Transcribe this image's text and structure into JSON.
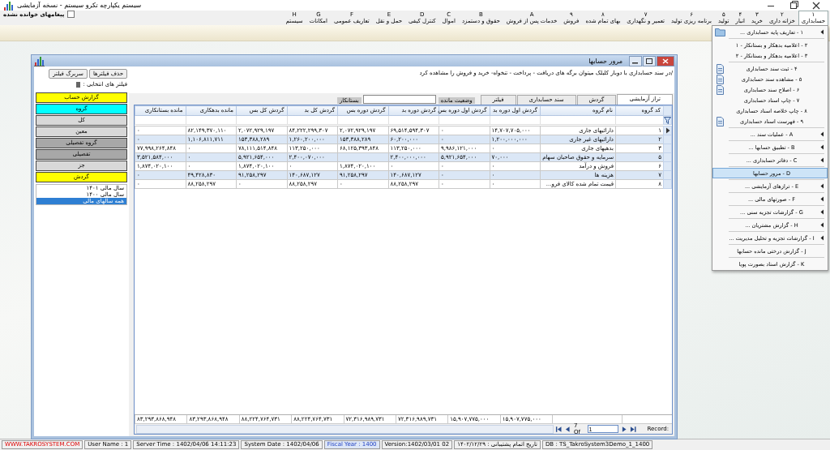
{
  "app_title": "سیستم یکپارچه تکرو سیستم - نسخه آزمایشی",
  "unread_messages": {
    "label": "پیغامهای خوانده نشده",
    "checked": false
  },
  "menu": [
    {
      "key": "۱",
      "label": "حسابداری",
      "selected": true
    },
    {
      "key": "۲",
      "label": "خزانه داری",
      "selected": false
    },
    {
      "key": "۳",
      "label": "خرید",
      "selected": false
    },
    {
      "key": "۴",
      "label": "انبار",
      "selected": false
    },
    {
      "key": "۵",
      "label": "تولید",
      "selected": false
    },
    {
      "key": "۶",
      "label": "برنامه ریزی تولید",
      "selected": false
    },
    {
      "key": "۷",
      "label": "تعمیر و نگهداری",
      "selected": false
    },
    {
      "key": "۸",
      "label": "بهای تمام شده",
      "selected": false
    },
    {
      "key": "۹",
      "label": "فروش",
      "selected": false
    },
    {
      "key": "A",
      "label": "خدمات پس از فروش",
      "selected": false
    },
    {
      "key": "B",
      "label": "حقوق و دستمزد",
      "selected": false
    },
    {
      "key": "C",
      "label": "اموال",
      "selected": false
    },
    {
      "key": "D",
      "label": "کنترل کیفی",
      "selected": false
    },
    {
      "key": "E",
      "label": "حمل و نقل",
      "selected": false
    },
    {
      "key": "F",
      "label": "تعاریف عمومی",
      "selected": false
    },
    {
      "key": "G",
      "label": "امکانات",
      "selected": false
    },
    {
      "key": "H",
      "label": "سیستم",
      "selected": false
    }
  ],
  "dropdown": [
    {
      "kind": "item",
      "label": "۱ - تعاریف پایه حسابداری ...",
      "submenu": true,
      "icon": true,
      "selected": false
    },
    {
      "kind": "separator"
    },
    {
      "kind": "item",
      "label": "۲ - اعلامیه بدهکار و بستانکار - ۱",
      "submenu": false,
      "icon": false,
      "selected": false
    },
    {
      "kind": "item",
      "label": "۳ - اعلامیه بدهکار و بستانکار - ۲",
      "submenu": false,
      "icon": false,
      "selected": false
    },
    {
      "kind": "separator"
    },
    {
      "kind": "item",
      "label": "۴ - ثبت سند حسابداری",
      "submenu": false,
      "icon": true,
      "selected": false
    },
    {
      "kind": "item",
      "label": "۵ - مشاهده سند حسابداری",
      "submenu": false,
      "icon": true,
      "selected": false
    },
    {
      "kind": "item",
      "label": "۶ - اصلاح سند حسابداری",
      "submenu": false,
      "icon": true,
      "selected": false
    },
    {
      "kind": "item",
      "label": "۷ - چاپ اسناد حسابداری",
      "submenu": false,
      "icon": false,
      "selected": false
    },
    {
      "kind": "item",
      "label": "۸ - چاپ خلاصه اسناد حسابداری",
      "submenu": false,
      "icon": false,
      "selected": false
    },
    {
      "kind": "item",
      "label": "۹ - فهرست اسناد حسابداری",
      "submenu": false,
      "icon": true,
      "selected": false
    },
    {
      "kind": "separator"
    },
    {
      "kind": "item",
      "label": "A - عملیات سند ...",
      "submenu": true,
      "icon": false,
      "selected": false
    },
    {
      "kind": "separator"
    },
    {
      "kind": "item",
      "label": "B - تطبیق حسابها ...",
      "submenu": true,
      "icon": false,
      "selected": false
    },
    {
      "kind": "separator"
    },
    {
      "kind": "item",
      "label": "C - دفاتر حسابداری ...",
      "submenu": true,
      "icon": false,
      "selected": false
    },
    {
      "kind": "separator"
    },
    {
      "kind": "item",
      "label": "D - مرور حسابها",
      "submenu": false,
      "icon": false,
      "selected": true
    },
    {
      "kind": "separator"
    },
    {
      "kind": "item",
      "label": "E - ترازهای آزمایشی ...",
      "submenu": true,
      "icon": false,
      "selected": false
    },
    {
      "kind": "separator"
    },
    {
      "kind": "item",
      "label": "F - صورتهای مالی ...",
      "submenu": true,
      "icon": false,
      "selected": false
    },
    {
      "kind": "separator"
    },
    {
      "kind": "item",
      "label": "G - گزارشات تجزیه سنی ...",
      "submenu": true,
      "icon": false,
      "selected": false
    },
    {
      "kind": "separator"
    },
    {
      "kind": "item",
      "label": "H - گزارش مشتریان ...",
      "submenu": true,
      "icon": false,
      "selected": false
    },
    {
      "kind": "separator"
    },
    {
      "kind": "item",
      "label": "I - گزارشات تجزیه و تحلیل مدیریت ...",
      "submenu": true,
      "icon": false,
      "selected": false
    },
    {
      "kind": "separator"
    },
    {
      "kind": "item",
      "label": "J - گزارش درختی مانده حسابها",
      "submenu": false,
      "icon": false,
      "selected": false
    },
    {
      "kind": "separator"
    },
    {
      "kind": "item",
      "label": "K - گزارش اسناد بصورت پویا",
      "submenu": false,
      "icon": false,
      "selected": false
    }
  ],
  "window": {
    "title": "مرور حسابها",
    "hint": "/در سند حسابداری با دوبار کلیلک میتوان برگه های دریافت - پرداخت - تنخواه- خرید و فروش را مشاهده کرد",
    "buttons": [
      "حذف فیلترها",
      "سربرگ فیلتر"
    ],
    "filters_label": "فیلتر های انتخابی :",
    "tabs": [
      {
        "label": "تراز آزمایشی",
        "selected": true
      },
      {
        "label": "گردش",
        "selected": false
      },
      {
        "label": "سند حسابداری",
        "selected": false
      },
      {
        "label": "فیلتر",
        "selected": false
      }
    ],
    "balance_status_label": "وضعیت مانده",
    "balance_option": "بستانکار",
    "table": {
      "columns": [
        "کد گروه",
        "نام گروه",
        "گردش اول دوره بد",
        "گردش اول دوره بس",
        "گردش دوره بد",
        "گردش دوره بس",
        "گردش کل بد",
        "گردش کل بس",
        "مانده بدهکاری",
        "مانده بستانکاری"
      ],
      "rows": [
        {
          "current": true,
          "cells": [
            "۱",
            "دارائیهای جاری",
            "۱۴,۷۰۷,۷۰۵,۰۰۰",
            "۰",
            "۶۹,۵۱۴,۵۹۴,۳۰۷",
            "۲,۰۷۲,۹۲۹,۱۹۷",
            "۸۴,۲۲۲,۲۹۹,۳۰۷",
            "۲,۰۷۲,۹۲۹,۱۹۷",
            "۸۲,۱۴۹,۳۷۰,۱۱۰",
            "۰"
          ]
        },
        {
          "current": false,
          "cells": [
            "۲",
            "دارائیهای غیر جاری",
            "۱,۲۰۰,۰۰۰,۰۰۰",
            "۰",
            "۶۰,۲۰۰,۰۰۰",
            "۱۵۳,۳۸۸,۲۸۹",
            "۱,۲۶۰,۲۰۰,۰۰۰",
            "۱۵۳,۳۸۸,۲۸۹",
            "۱,۱۰۶,۸۱۱,۷۱۱",
            "۰"
          ]
        },
        {
          "current": false,
          "cells": [
            "۳",
            "بدهیهای جاری",
            "۰",
            "۹,۹۸۶,۱۲۱,۰۰۰",
            "۱۱۳,۲۵۰,۰۰۰",
            "۶۸,۱۲۵,۳۹۳,۸۴۸",
            "۱۱۳,۲۵۰,۰۰۰",
            "۷۸,۱۱۱,۵۱۴,۸۴۸",
            "۰",
            "۷۷,۹۹۸,۲۶۴,۸۴۸"
          ]
        },
        {
          "current": false,
          "cells": [
            "۵",
            "سرمایه و حقوق صاحبان سهام",
            "۷۰,۰۰۰",
            "۵,۹۲۱,۶۵۴,۰۰۰",
            "۲,۴۰۰,۰۰۰,۰۰۰",
            "",
            "۲,۴۰۰,۰۷۰,۰۰۰",
            "۵,۹۲۱,۶۵۴,۰۰۰",
            "۰",
            "۳,۵۲۱,۵۸۴,۰۰۰"
          ]
        },
        {
          "current": false,
          "cells": [
            "۶",
            "فروش و درآمد",
            "۰",
            "۰",
            "۰",
            "۱,۸۷۴,۰۲۰,۱۰۰",
            "۰",
            "۱,۸۷۴,۰۲۰,۱۰۰",
            "۰",
            "۱,۸۷۴,۰۲۰,۱۰۰"
          ]
        },
        {
          "current": false,
          "cells": [
            "۷",
            "هزینه ها",
            "۰",
            "۰",
            "۱۴۰,۶۸۷,۱۲۷",
            "۹۱,۲۵۸,۲۹۷",
            "۱۴۰,۶۸۷,۱۲۷",
            "۹۱,۲۵۸,۲۹۷",
            "۴۹,۴۲۸,۸۳۰",
            "۰"
          ]
        },
        {
          "current": false,
          "cells": [
            "۸",
            "قیمت تمام شده کالای فرو...",
            "۰",
            "۰",
            "۸۸,۲۵۸,۲۹۷",
            "۰",
            "۸۸,۲۵۸,۲۹۷",
            "۰",
            "۸۸,۲۵۸,۲۹۷",
            "۰"
          ]
        }
      ],
      "totals": [
        "۱۵,۹۰۷,۷۷۵,۰۰۰",
        "۱۵,۹۰۷,۷۷۵,۰۰۰",
        "۷۲,۳۱۶,۹۸۹,۷۳۱",
        "۷۲,۳۱۶,۹۸۹,۷۳۱",
        "۸۸,۲۲۴,۷۶۴,۷۳۱",
        "۸۸,۲۲۴,۷۶۴,۷۳۱",
        "۸۳,۲۹۳,۸۶۸,۹۴۸",
        "۸۳,۲۹۳,۸۶۸,۹۴۸"
      ],
      "pager": {
        "count": "7 Of",
        "current": "1",
        "record_label": "Record:"
      }
    },
    "report_buttons": [
      {
        "label": "گزارش حساب",
        "color": "#ffff00"
      },
      {
        "label": "گروه",
        "color": "#00ffff"
      },
      {
        "label": "کل",
        "color": "#d8d8d8"
      },
      {
        "label": "معین",
        "color": "#d8d8d8"
      },
      {
        "label": "گروه تفصیلی",
        "color": "#a8a8a8"
      },
      {
        "label": "تفصیلی",
        "color": "#a8a8a8"
      },
      {
        "label": "جز",
        "color": "#d8d8d8"
      },
      {
        "label": "گردش",
        "color": "#ffff00"
      }
    ],
    "fiscal_years": [
      {
        "label": "سال مالی ۱۴۰۱",
        "selected": false
      },
      {
        "label": "سال مالی ۱۴۰۰",
        "selected": false
      },
      {
        "label": "همه سالهای مالی",
        "selected": true
      }
    ]
  },
  "status_bar": [
    {
      "kind": "plain",
      "text": "DB : TS_TakroSystem3Demo_1_1400"
    },
    {
      "kind": "plain",
      "text": "تاریخ اتمام پشتیبانی : ۱۴۰۲/۱۲/۲۹"
    },
    {
      "kind": "plain",
      "text": "Version:1402/03/01  02"
    },
    {
      "kind": "fiscal",
      "text": "Fiscal Year : 1400"
    },
    {
      "kind": "plain",
      "text": "System Date : 1402/04/06"
    },
    {
      "kind": "plain",
      "text": "Server Time : 1402/04/06  14:11:23"
    },
    {
      "kind": "plain",
      "text": "User Name : 1"
    },
    {
      "kind": "url",
      "text": "WWW.TAKROSYSTEM.COM"
    }
  ]
}
